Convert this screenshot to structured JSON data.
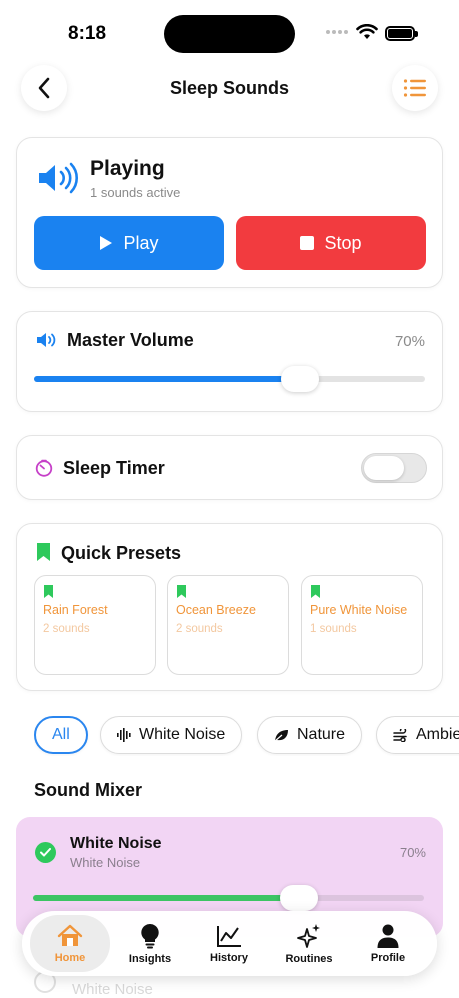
{
  "status_bar": {
    "time": "8:18"
  },
  "header": {
    "title": "Sleep Sounds",
    "back_icon": "chevron-left-icon",
    "menu_icon": "list-icon"
  },
  "playing": {
    "title": "Playing",
    "subtitle": "1 sounds active",
    "play_label": "Play",
    "stop_label": "Stop",
    "colors": {
      "play": "#1a82f0",
      "stop": "#f23b3f",
      "speaker": "#1a82f0"
    }
  },
  "volume": {
    "title": "Master Volume",
    "value_text": "70%",
    "level": 0.68,
    "color": "#1a82f0"
  },
  "timer": {
    "title": "Sleep Timer",
    "enabled": false,
    "icon_color": "#c640c8"
  },
  "presets": {
    "title": "Quick Presets",
    "icon_color": "#2ec95c",
    "items": [
      {
        "name": "Rain Forest",
        "count": "2 sounds"
      },
      {
        "name": "Ocean Breeze",
        "count": "2 sounds"
      },
      {
        "name": "Pure White Noise",
        "count": "1 sounds"
      }
    ]
  },
  "filters": [
    {
      "label": "All",
      "icon": ""
    },
    {
      "label": "White Noise",
      "icon": "waveform-icon"
    },
    {
      "label": "Nature",
      "icon": "leaf-icon"
    },
    {
      "label": "Ambient",
      "icon": "wind-icon"
    }
  ],
  "mixer": {
    "title": "Sound Mixer",
    "items": [
      {
        "name": "White Noise",
        "category": "White Noise",
        "value_text": "70%",
        "level": 0.68,
        "selected": true,
        "background": "#f2d5f4",
        "slider_color": "#3cc463"
      },
      {
        "name": "White Noise"
      }
    ]
  },
  "tabs": [
    {
      "label": "Home",
      "icon": "house-icon",
      "active": true
    },
    {
      "label": "Insights",
      "icon": "lightbulb-icon",
      "active": false
    },
    {
      "label": "History",
      "icon": "chart-line-icon",
      "active": false
    },
    {
      "label": "Routines",
      "icon": "sparkles-icon",
      "active": false
    },
    {
      "label": "Profile",
      "icon": "person-icon",
      "active": false
    }
  ]
}
